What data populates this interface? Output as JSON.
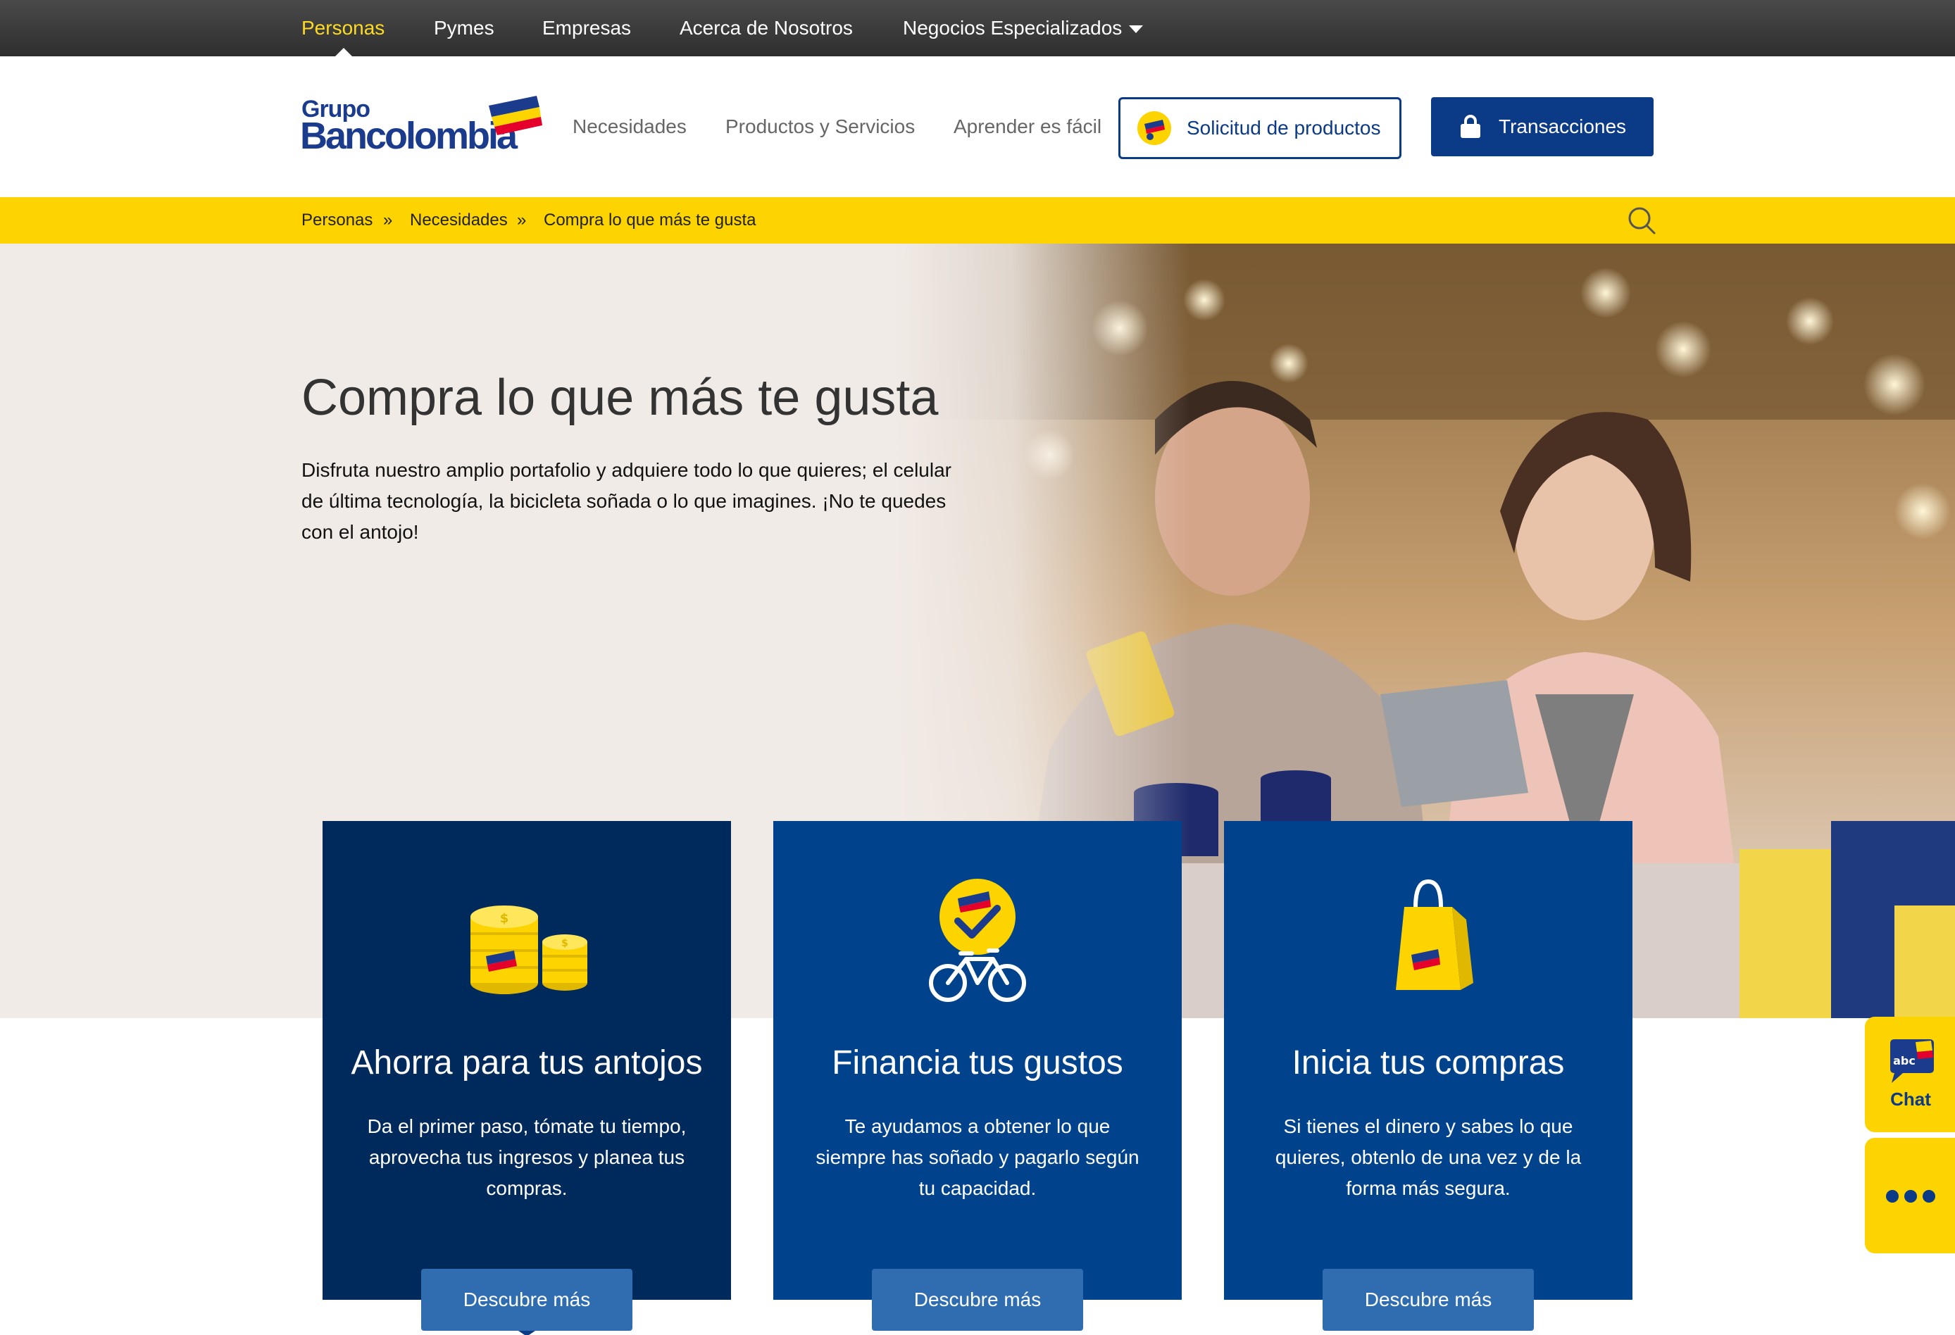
{
  "topnav": {
    "items": [
      "Personas",
      "Pymes",
      "Empresas",
      "Acerca de Nosotros",
      "Negocios Especializados"
    ],
    "active": "Personas"
  },
  "logo": {
    "line1": "Grupo",
    "line2": "Bancolombia"
  },
  "mainnav": {
    "items": [
      "Necesidades",
      "Productos y Servicios",
      "Aprender es fácil"
    ],
    "solicitud": "Solicitud de productos",
    "transacciones": "Transacciones"
  },
  "breadcrumb": {
    "items": [
      "Personas",
      "Necesidades",
      "Compra lo que más te gusta"
    ],
    "separator": "»"
  },
  "hero": {
    "title": "Compra lo que más te gusta",
    "text": "Disfruta nuestro amplio portafolio y adquiere todo lo que quieres;  el celular de última tecnología, la bicicleta soñada o lo que imagines. ¡No te quedes con el antojo!"
  },
  "cards": [
    {
      "title": "Ahorra para tus antojos",
      "desc": "Da el primer paso, tómate tu tiempo, aprovecha tus ingresos y planea tus compras.",
      "button": "Descubre más",
      "icon": "coins-icon",
      "bg": "#002a5c"
    },
    {
      "title": "Financia tus gustos",
      "desc": "Te ayudamos a obtener lo que siempre has soñado y pagarlo según tu capacidad.",
      "button": "Descubre más",
      "icon": "bicycle-icon",
      "bg": "#00428c"
    },
    {
      "title": "Inicia tus compras",
      "desc": "Si tienes el dinero y sabes lo que quieres, obtenlo de una vez y de la forma más segura.",
      "button": "Descubre más",
      "icon": "shopping-bag-icon",
      "bg": "#00428c"
    }
  ],
  "widgets": {
    "chat_badge": "abc",
    "chat_label": "Chat",
    "more": "more-options-icon"
  },
  "colors": {
    "yellow": "#fdd300",
    "blue": "#0b3a86",
    "navy": "#002a5c",
    "mid_blue": "#00428c"
  }
}
